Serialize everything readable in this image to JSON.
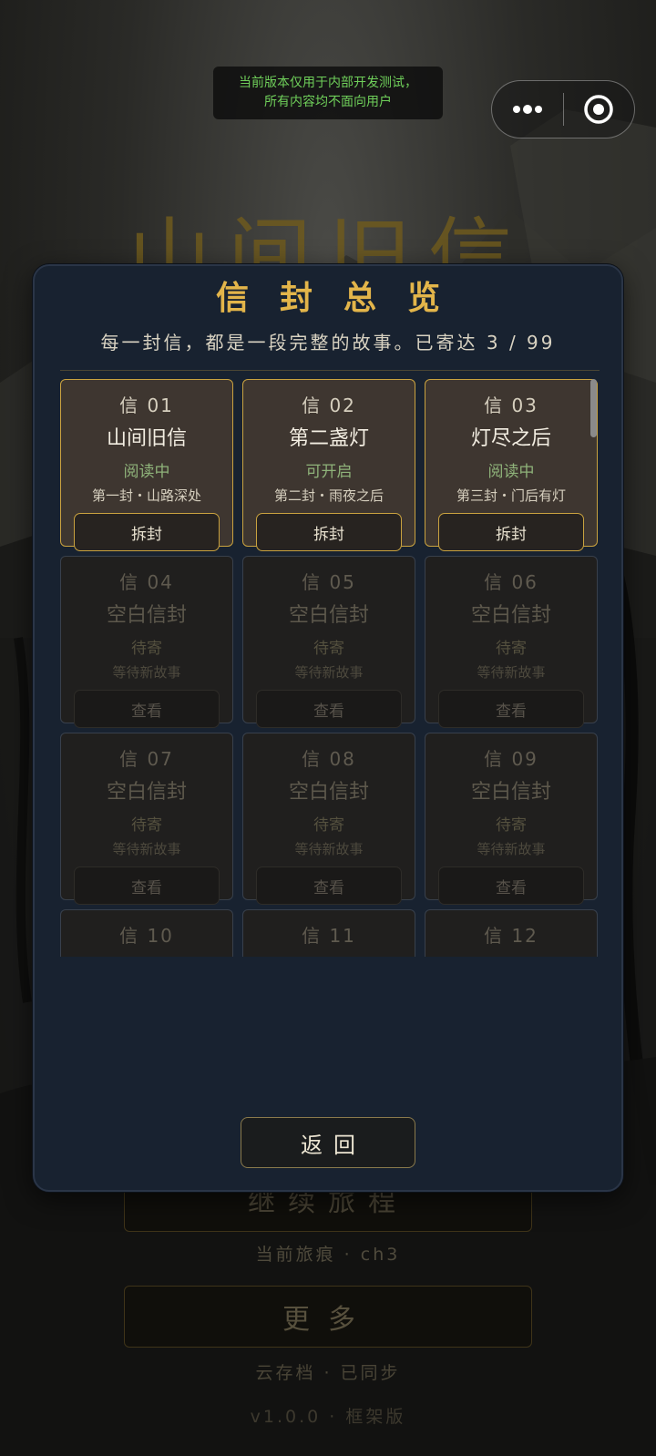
{
  "dev_notice": {
    "line1": "当前版本仅用于内部开发测试，",
    "line2": "所有内容均不面向用户"
  },
  "capsule": {
    "more_icon": "more-dots-icon",
    "close_icon": "target-circle-icon"
  },
  "background": {
    "game_title": "山间旧信",
    "continue_label": "继续旅程",
    "trace_text": "当前旅痕 · ch3",
    "more_label": "更多",
    "cloud_text": "云存档 · 已同步",
    "version_text": "v1.0.0 · 框架版"
  },
  "panel": {
    "title": "信封总览",
    "subtitle": "每一封信，都是一段完整的故事。已寄达 3 / 99",
    "back_label": "返回",
    "letters": [
      {
        "num": "信 01",
        "name": "山间旧信",
        "status": "阅读中",
        "desc": "第一封・山路深处",
        "action": "拆封",
        "active": true
      },
      {
        "num": "信 02",
        "name": "第二盏灯",
        "status": "可开启",
        "desc": "第二封・雨夜之后",
        "action": "拆封",
        "active": true
      },
      {
        "num": "信 03",
        "name": "灯尽之后",
        "status": "阅读中",
        "desc": "第三封・门后有灯",
        "action": "拆封",
        "active": true
      },
      {
        "num": "信 04",
        "name": "空白信封",
        "status": "待寄",
        "desc": "等待新故事",
        "action": "查看",
        "active": false
      },
      {
        "num": "信 05",
        "name": "空白信封",
        "status": "待寄",
        "desc": "等待新故事",
        "action": "查看",
        "active": false
      },
      {
        "num": "信 06",
        "name": "空白信封",
        "status": "待寄",
        "desc": "等待新故事",
        "action": "查看",
        "active": false
      },
      {
        "num": "信 07",
        "name": "空白信封",
        "status": "待寄",
        "desc": "等待新故事",
        "action": "查看",
        "active": false
      },
      {
        "num": "信 08",
        "name": "空白信封",
        "status": "待寄",
        "desc": "等待新故事",
        "action": "查看",
        "active": false
      },
      {
        "num": "信 09",
        "name": "空白信封",
        "status": "待寄",
        "desc": "等待新故事",
        "action": "查看",
        "active": false
      },
      {
        "num": "信 10"
      },
      {
        "num": "信 11"
      },
      {
        "num": "信 12"
      }
    ]
  },
  "colors": {
    "accent_gold": "#c9a23f",
    "title_gold": "#e3b54a",
    "panel_bg": "#182230",
    "status_green": "#8fb37a",
    "notice_green": "#6fcf5a"
  }
}
